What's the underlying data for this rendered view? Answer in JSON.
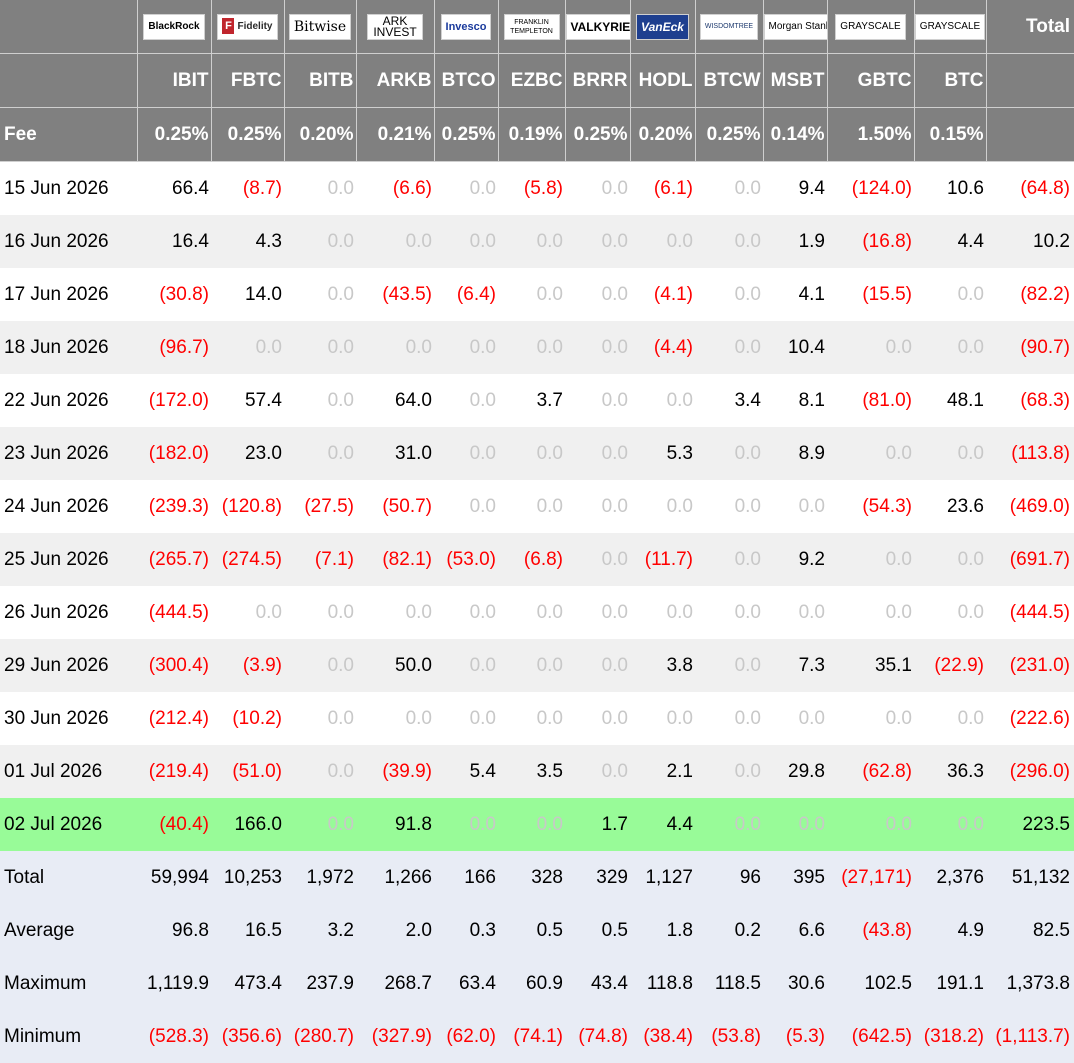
{
  "logos": [
    "BlackRock",
    "Fidelity",
    "Bitwise",
    "ARK INVEST",
    "Invesco",
    "FRANKLIN TEMPLETON",
    "VALKYRIE",
    "VanEck",
    "WISDOMTREE",
    "Morgan Stanley",
    "GRAYSCALE",
    "GRAYSCALE"
  ],
  "header": {
    "total_label": "Total",
    "fee_label": "Fee",
    "tickers": [
      "IBIT",
      "FBTC",
      "BITB",
      "ARKB",
      "BTCO",
      "EZBC",
      "BRRR",
      "HODL",
      "BTCW",
      "MSBT",
      "GBTC",
      "BTC"
    ],
    "fees": [
      "0.25%",
      "0.25%",
      "0.20%",
      "0.21%",
      "0.25%",
      "0.19%",
      "0.25%",
      "0.20%",
      "0.25%",
      "0.14%",
      "1.50%",
      "0.15%"
    ]
  },
  "rows": [
    {
      "date": "15 Jun 2026",
      "values": [
        "66.4",
        "(8.7)",
        "0.0",
        "(6.6)",
        "0.0",
        "(5.8)",
        "0.0",
        "(6.1)",
        "0.0",
        "9.4",
        "(124.0)",
        "10.6"
      ],
      "total": "(64.8)"
    },
    {
      "date": "16 Jun 2026",
      "values": [
        "16.4",
        "4.3",
        "0.0",
        "0.0",
        "0.0",
        "0.0",
        "0.0",
        "0.0",
        "0.0",
        "1.9",
        "(16.8)",
        "4.4"
      ],
      "total": "10.2"
    },
    {
      "date": "17 Jun 2026",
      "values": [
        "(30.8)",
        "14.0",
        "0.0",
        "(43.5)",
        "(6.4)",
        "0.0",
        "0.0",
        "(4.1)",
        "0.0",
        "4.1",
        "(15.5)",
        "0.0"
      ],
      "total": "(82.2)"
    },
    {
      "date": "18 Jun 2026",
      "values": [
        "(96.7)",
        "0.0",
        "0.0",
        "0.0",
        "0.0",
        "0.0",
        "0.0",
        "(4.4)",
        "0.0",
        "10.4",
        "0.0",
        "0.0"
      ],
      "total": "(90.7)"
    },
    {
      "date": "22 Jun 2026",
      "values": [
        "(172.0)",
        "57.4",
        "0.0",
        "64.0",
        "0.0",
        "3.7",
        "0.0",
        "0.0",
        "3.4",
        "8.1",
        "(81.0)",
        "48.1"
      ],
      "total": "(68.3)"
    },
    {
      "date": "23 Jun 2026",
      "values": [
        "(182.0)",
        "23.0",
        "0.0",
        "31.0",
        "0.0",
        "0.0",
        "0.0",
        "5.3",
        "0.0",
        "8.9",
        "0.0",
        "0.0"
      ],
      "total": "(113.8)"
    },
    {
      "date": "24 Jun 2026",
      "values": [
        "(239.3)",
        "(120.8)",
        "(27.5)",
        "(50.7)",
        "0.0",
        "0.0",
        "0.0",
        "0.0",
        "0.0",
        "0.0",
        "(54.3)",
        "23.6"
      ],
      "total": "(469.0)"
    },
    {
      "date": "25 Jun 2026",
      "values": [
        "(265.7)",
        "(274.5)",
        "(7.1)",
        "(82.1)",
        "(53.0)",
        "(6.8)",
        "0.0",
        "(11.7)",
        "0.0",
        "9.2",
        "0.0",
        "0.0"
      ],
      "total": "(691.7)"
    },
    {
      "date": "26 Jun 2026",
      "values": [
        "(444.5)",
        "0.0",
        "0.0",
        "0.0",
        "0.0",
        "0.0",
        "0.0",
        "0.0",
        "0.0",
        "0.0",
        "0.0",
        "0.0"
      ],
      "total": "(444.5)"
    },
    {
      "date": "29 Jun 2026",
      "values": [
        "(300.4)",
        "(3.9)",
        "0.0",
        "50.0",
        "0.0",
        "0.0",
        "0.0",
        "3.8",
        "0.0",
        "7.3",
        "35.1",
        "(22.9)"
      ],
      "total": "(231.0)"
    },
    {
      "date": "30 Jun 2026",
      "values": [
        "(212.4)",
        "(10.2)",
        "0.0",
        "0.0",
        "0.0",
        "0.0",
        "0.0",
        "0.0",
        "0.0",
        "0.0",
        "0.0",
        "0.0"
      ],
      "total": "(222.6)"
    },
    {
      "date": "01 Jul 2026",
      "values": [
        "(219.4)",
        "(51.0)",
        "0.0",
        "(39.9)",
        "5.4",
        "3.5",
        "0.0",
        "2.1",
        "0.0",
        "29.8",
        "(62.8)",
        "36.3"
      ],
      "total": "(296.0)"
    },
    {
      "date": "02 Jul 2026",
      "values": [
        "(40.4)",
        "166.0",
        "0.0",
        "91.8",
        "0.0",
        "0.0",
        "1.7",
        "4.4",
        "0.0",
        "0.0",
        "0.0",
        "0.0"
      ],
      "total": "223.5",
      "highlight": true
    }
  ],
  "summary": [
    {
      "label": "Total",
      "values": [
        "59,994",
        "10,253",
        "1,972",
        "1,266",
        "166",
        "328",
        "329",
        "1,127",
        "96",
        "395",
        "(27,171)",
        "2,376"
      ],
      "total": "51,132"
    },
    {
      "label": "Average",
      "values": [
        "96.8",
        "16.5",
        "3.2",
        "2.0",
        "0.3",
        "0.5",
        "0.5",
        "1.8",
        "0.2",
        "6.6",
        "(43.8)",
        "4.9"
      ],
      "total": "82.5"
    },
    {
      "label": "Maximum",
      "values": [
        "1,119.9",
        "473.4",
        "237.9",
        "268.7",
        "63.4",
        "60.9",
        "43.4",
        "118.8",
        "118.5",
        "30.6",
        "102.5",
        "191.1"
      ],
      "total": "1,373.8"
    },
    {
      "label": "Minimum",
      "values": [
        "(528.3)",
        "(356.6)",
        "(280.7)",
        "(327.9)",
        "(62.0)",
        "(74.1)",
        "(74.8)",
        "(38.4)",
        "(53.8)",
        "(5.3)",
        "(642.5)",
        "(318.2)"
      ],
      "total": "(1,113.7)"
    }
  ],
  "colors": {
    "header_bg": "#808080",
    "negative": "#ff0000",
    "zero": "#c8c8c8",
    "highlight_row": "#98fb98",
    "summary_bg": "#e8ecf5",
    "alt_row": "#f0f0f0"
  }
}
